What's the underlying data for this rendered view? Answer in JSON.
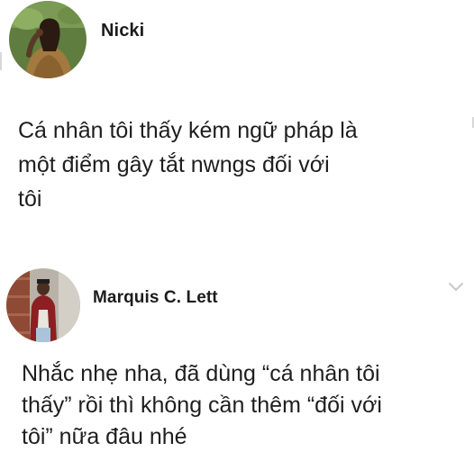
{
  "posts": [
    {
      "author": "Nicki",
      "lines": [
        "Cá nhân tôi thấy kém ngữ pháp là",
        "một điểm gây tắt nwngs đối với",
        "tôi"
      ]
    },
    {
      "author": "Marquis C. Lett",
      "lines": [
        "Nhắc nhẹ nha, đã dùng “cá nhân tôi",
        "thấy” rồi thì không cần thêm “đối với",
        "tôi” nữa đâu nhé"
      ]
    }
  ],
  "icons": {
    "options": "chevron-down-icon"
  },
  "colors": {
    "text": "#1c1c1c",
    "muted": "#c8c8c8",
    "background": "#ffffff"
  }
}
